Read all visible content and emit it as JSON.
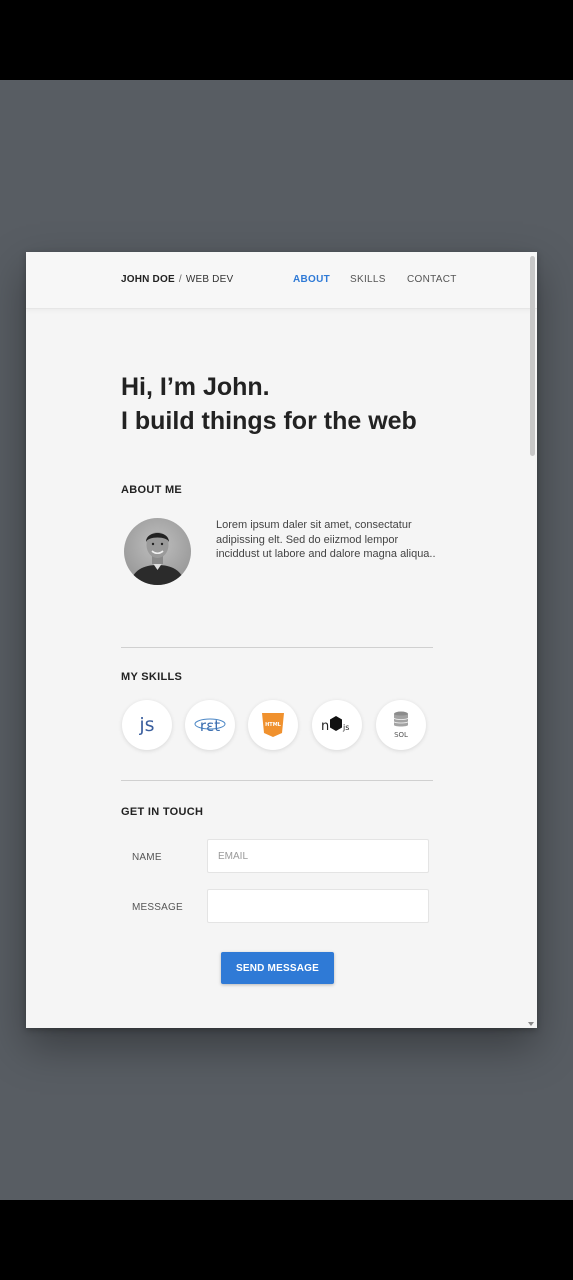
{
  "header": {
    "brand_name": "JOHN DOE",
    "brand_separator": "/",
    "brand_role": "WEB DEV",
    "nav": [
      {
        "label": "ABOUT",
        "active": true
      },
      {
        "label": "SKILLS",
        "active": false
      },
      {
        "label": "CONTACT",
        "active": false
      }
    ]
  },
  "hero": {
    "line1": "Hi, I’m John.",
    "line2": "I build things for the web"
  },
  "about": {
    "title": "ABOUT ME",
    "text": "Lorem ipsum daler sit amet, consectatur adipissing elt. Sed do eiizmod lempor inciddust ut labore and dalore magna aliqua.."
  },
  "skills": {
    "title": "MY SKILLS",
    "items": [
      {
        "name": "javascript",
        "icon": "js-icon",
        "label": "js"
      },
      {
        "name": "react",
        "icon": "react-icon",
        "label": "rεt"
      },
      {
        "name": "html",
        "icon": "html5-icon",
        "label": "HTML"
      },
      {
        "name": "nodejs",
        "icon": "nodejs-icon",
        "label": "js"
      },
      {
        "name": "sql",
        "icon": "database-icon",
        "label": "SOL"
      }
    ]
  },
  "contact": {
    "title": "GET IN TOUCH",
    "name_label": "NAME",
    "email_placeholder": "EMAIL",
    "message_label": "MESSAGE",
    "message_value": "",
    "send_label": "SEND MESSAGE"
  },
  "colors": {
    "accent": "#2f7ad6",
    "backdrop": "#585d63",
    "page": "#f5f5f5",
    "html_orange": "#f0912e"
  }
}
